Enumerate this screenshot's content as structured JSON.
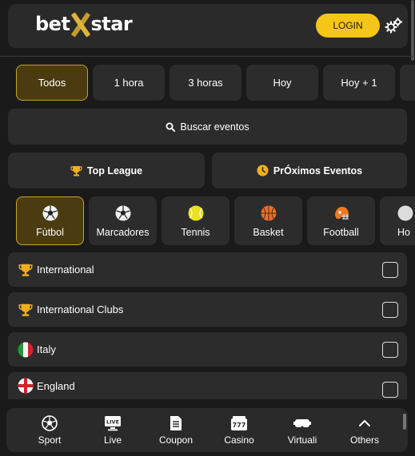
{
  "header": {
    "logo_left": "bet",
    "logo_right": "star",
    "login_label": "LOGIN"
  },
  "time_filters": [
    "Todos",
    "1 hora",
    "3 horas",
    "Hoy",
    "Hoy + 1"
  ],
  "search": {
    "label": "Buscar eventos"
  },
  "quick_links": {
    "top_league": "Top League",
    "upcoming": "PrÓximos Eventos"
  },
  "sports": [
    "Fùtbol",
    "Marcadores",
    "Tennis",
    "Basket",
    "Football",
    "Ho"
  ],
  "leagues": [
    "International",
    "International Clubs",
    "Italy",
    "England"
  ],
  "bottom_nav": {
    "sport": "Sport",
    "live": "Live",
    "coupon": "Coupon",
    "casino": "Casino",
    "virtuali": "Virtuali",
    "others": "Others"
  },
  "colors": {
    "accent": "#f5c518",
    "active_bg": "#4a3c10",
    "panel": "#2c2c2c"
  }
}
